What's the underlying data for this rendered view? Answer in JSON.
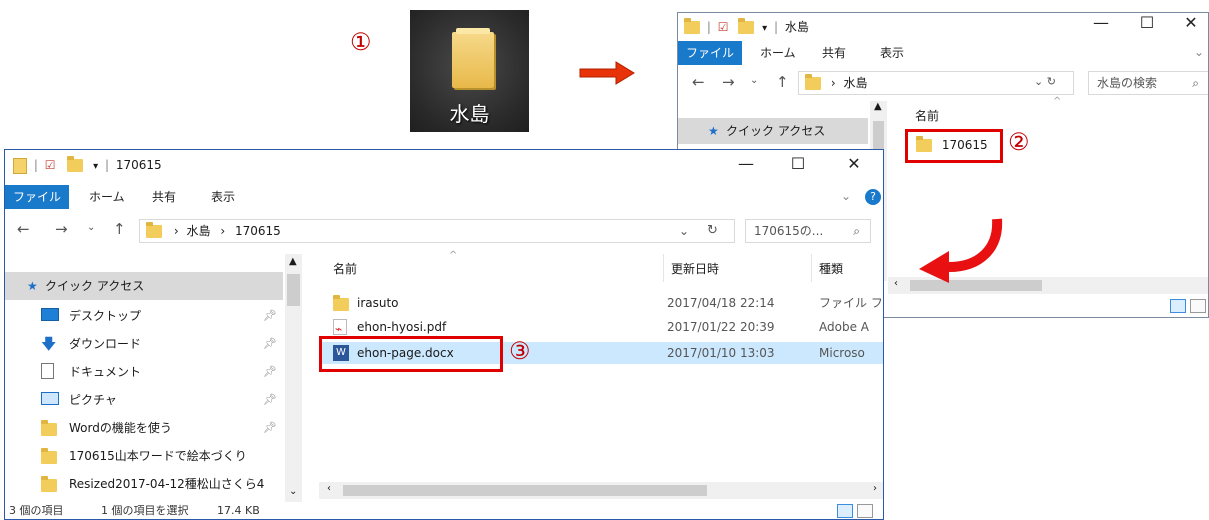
{
  "steps": {
    "s1": "①",
    "s2": "②",
    "s3": "③"
  },
  "desktop": {
    "folder_label": "水島"
  },
  "win2": {
    "title": "水島",
    "tabs": [
      "ファイル",
      "ホーム",
      "共有",
      "表示"
    ],
    "path": [
      "水島"
    ],
    "search_placeholder": "水島の検索",
    "col_name": "名前",
    "nav_quick": "クイック アクセス",
    "item": "170615",
    "controls": {
      "min": "—",
      "max": "☐",
      "close": "✕"
    }
  },
  "win1": {
    "title": "170615",
    "tabs": [
      "ファイル",
      "ホーム",
      "共有",
      "表示"
    ],
    "path": [
      "水島",
      "170615"
    ],
    "search_placeholder": "170615の...",
    "columns": {
      "name": "名前",
      "date": "更新日時",
      "type": "種類"
    },
    "nav": {
      "quick": "クイック アクセス",
      "items": [
        "デスクトップ",
        "ダウンロード",
        "ドキュメント",
        "ピクチャ",
        "Wordの機能を使う",
        "170615山本ワードで絵本づくり",
        "Resized2017-04-12種松山さくら4"
      ]
    },
    "files": [
      {
        "name": "irasuto",
        "date": "2017/04/18 22:14",
        "type": "ファイル フ"
      },
      {
        "name": "ehon-hyosi.pdf",
        "date": "2017/01/22 20:39",
        "type": "Adobe A"
      },
      {
        "name": "ehon-page.docx",
        "date": "2017/01/10 13:03",
        "type": "Microso"
      }
    ],
    "status": {
      "count": "3 個の項目",
      "selected": "1 個の項目を選択",
      "size": "17.4 KB"
    },
    "controls": {
      "min": "—",
      "max": "☐",
      "close": "✕"
    }
  },
  "colors": {
    "accent": "#1979ca",
    "highlight": "#e00000",
    "selection": "#cce8ff"
  }
}
